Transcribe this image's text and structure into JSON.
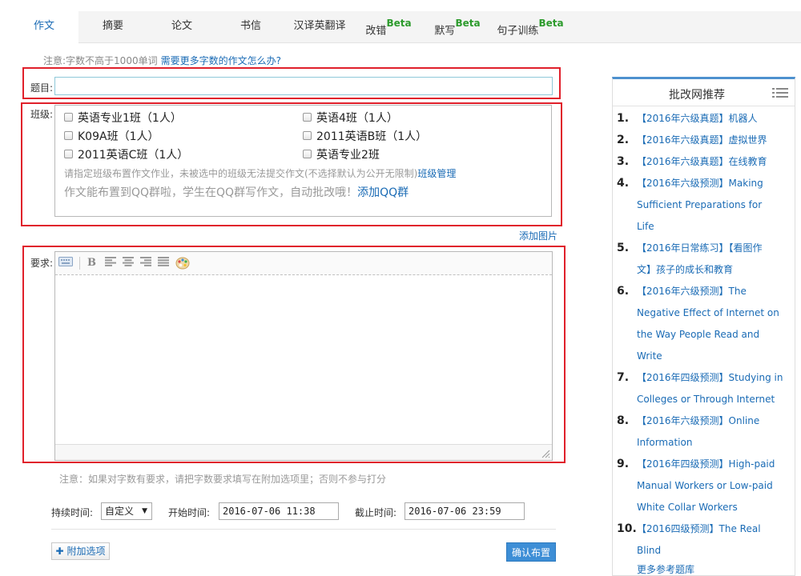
{
  "tabs": [
    {
      "label": "作文",
      "beta": ""
    },
    {
      "label": "摘要",
      "beta": ""
    },
    {
      "label": "论文",
      "beta": ""
    },
    {
      "label": "书信",
      "beta": ""
    },
    {
      "label": "汉译英翻译",
      "beta": ""
    },
    {
      "label": "改错",
      "beta": "Beta"
    },
    {
      "label": "默写",
      "beta": "Beta"
    },
    {
      "label": "句子训练",
      "beta": "Beta"
    }
  ],
  "notice_top": {
    "text": "注意:字数不高于1000单词",
    "link": "需要更多字数的作文怎么办?"
  },
  "title_field": {
    "label": "题目:",
    "value": ""
  },
  "class_section": {
    "label": "班级:",
    "classes": [
      "英语专业1班（1人）",
      "英语4班（1人）",
      "K09A班（1人）",
      "2011英语B班（1人）",
      "2011英语C班（1人）",
      "英语专业2班"
    ],
    "hint": "请指定班级布置作文作业，未被选中的班级无法提交作文(不选择默认为公开无限制)",
    "manage_link": "班级管理",
    "qq_hint": "作文能布置到QQ群啦，学生在QQ群写作文，自动批改哦！",
    "qq_link": "添加QQ群"
  },
  "add_image_link": "添加图片",
  "requirement": {
    "label": "要求:",
    "value": ""
  },
  "notice_bottom": "注意：如果对字数有要求，请把字数要求填写在附加选项里；否则不参与打分",
  "timing": {
    "duration_label": "持续时间:",
    "duration_value": "自定义",
    "start_label": "开始时间:",
    "start_value": "2016-07-06 11:38",
    "end_label": "截止时间:",
    "end_value": "2016-07-06 23:59"
  },
  "extra_options_button": "附加选项",
  "confirm_button": "确认布置",
  "sidebar": {
    "title": "批改网推荐",
    "items": [
      {
        "num": "1.",
        "lines": [
          "【2016年六级真题】机器人"
        ]
      },
      {
        "num": "2.",
        "lines": [
          "【2016年六级真题】虚拟世界"
        ]
      },
      {
        "num": "3.",
        "lines": [
          "【2016年六级真题】在线教育"
        ]
      },
      {
        "num": "4.",
        "lines": [
          "【2016年六级预测】Making",
          "Sufficient Preparations for",
          "Life"
        ]
      },
      {
        "num": "5.",
        "lines": [
          "【2016年日常练习】【看图作",
          "文】孩子的成长和教育"
        ]
      },
      {
        "num": "6.",
        "lines": [
          "【2016年六级预测】The",
          "Negative Effect of Internet on",
          "the Way People Read and",
          "Write"
        ]
      },
      {
        "num": "7.",
        "lines": [
          "【2016年四级预测】Studying in",
          "Colleges or Through Internet"
        ]
      },
      {
        "num": "8.",
        "lines": [
          "【2016年六级预测】Online",
          "Information"
        ]
      },
      {
        "num": "9.",
        "lines": [
          "【2016年四级预测】High-paid",
          "Manual Workers or Low-paid",
          "White Collar Workers"
        ]
      },
      {
        "num": "10.",
        "lines": [
          "【2016四级预测】The Real",
          "Blind"
        ]
      }
    ],
    "more_link": "更多参考题库"
  },
  "colors": {
    "accent": "#1a6bb5",
    "highlight": "#e0202b",
    "beta": "#2c9b2c",
    "button": "#3d8ed6"
  }
}
